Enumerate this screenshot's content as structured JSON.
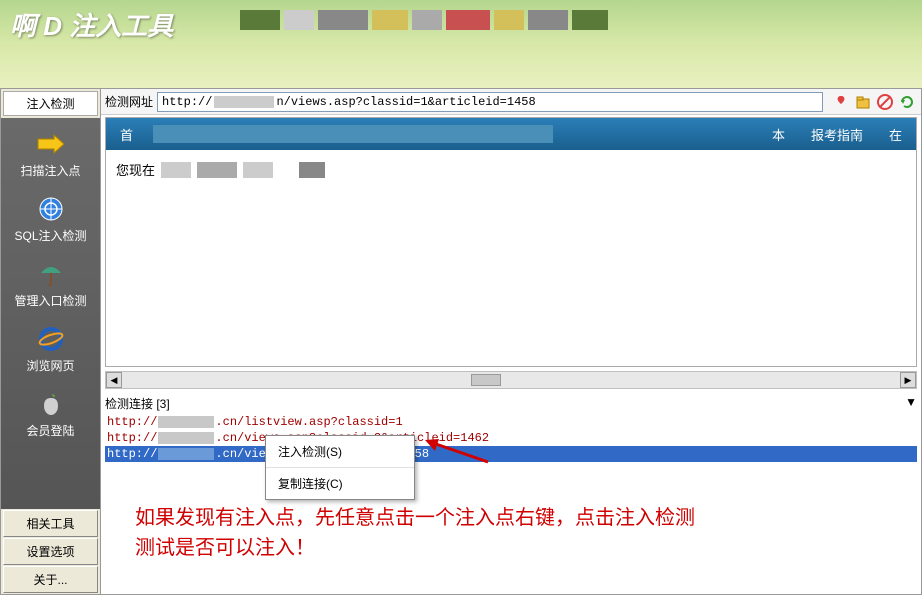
{
  "header": {
    "title": "啊 D 注入工具"
  },
  "sidebar": {
    "top_tab": "注入检测",
    "items": [
      {
        "label": "扫描注入点",
        "icon": "arrow-right"
      },
      {
        "label": "SQL注入检测",
        "icon": "target"
      },
      {
        "label": "管理入口检测",
        "icon": "umbrella"
      },
      {
        "label": "浏览网页",
        "icon": "ie"
      },
      {
        "label": "会员登陆",
        "icon": "apple"
      }
    ],
    "bottom": [
      "相关工具",
      "设置选项",
      "关于..."
    ]
  },
  "toolbar": {
    "label": "检测网址",
    "url_prefix": "http://",
    "url_suffix": "n/views.asp?classid=1&articleid=1458",
    "icons": [
      "favorite",
      "open",
      "stop",
      "refresh"
    ]
  },
  "browser": {
    "nav_first": "首",
    "nav_right1": "本",
    "nav_right2": "报考指南",
    "nav_right3": "在",
    "body_prefix": "您现在"
  },
  "links": {
    "header": "检测连接  [3]",
    "rows": [
      {
        "pre": "http://",
        "post": ".cn/listview.asp?classid=1",
        "sel": false
      },
      {
        "pre": "http://",
        "post": ".cn/views.asp?classid=2&articleid=1462",
        "sel": false
      },
      {
        "pre": "http://",
        "post": ".cn/views.a",
        "tail": "58",
        "sel": true
      }
    ]
  },
  "context_menu": {
    "item1": "注入检测(S)",
    "item2": "复制连接(C)"
  },
  "annotation": {
    "line1": "如果发现有注入点，先任意点击一个注入点右键，点击注入检测",
    "line2": "测试是否可以注入！"
  }
}
